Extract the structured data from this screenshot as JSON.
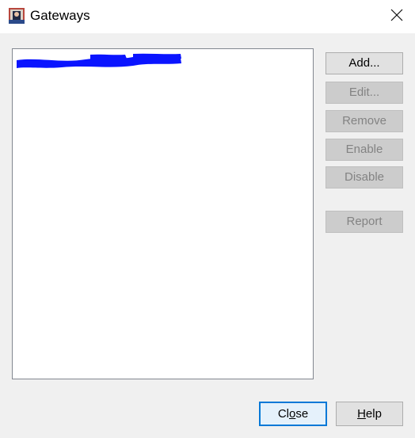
{
  "window": {
    "title": "Gateways",
    "app_icon": "java-duke-icon",
    "close_icon": "close-icon"
  },
  "list": {
    "items": [
      {
        "label": "",
        "note": "redacted-entry"
      }
    ]
  },
  "buttons": {
    "add": {
      "label": "Add...",
      "enabled": true
    },
    "edit": {
      "label": "Edit...",
      "enabled": false
    },
    "remove": {
      "label": "Remove",
      "enabled": false
    },
    "enable": {
      "label": "Enable",
      "enabled": false
    },
    "disable": {
      "label": "Disable",
      "enabled": false
    },
    "report": {
      "label": "Report",
      "enabled": false
    },
    "close": {
      "pre": "Cl",
      "mnemonic": "o",
      "post": "se",
      "default": true
    },
    "help": {
      "pre": "",
      "mnemonic": "H",
      "post": "elp"
    }
  },
  "colors": {
    "dialog_bg": "#f0f0f0",
    "titlebar_bg": "#ffffff",
    "accent": "#0078d7",
    "redaction": "#0a14ff"
  }
}
